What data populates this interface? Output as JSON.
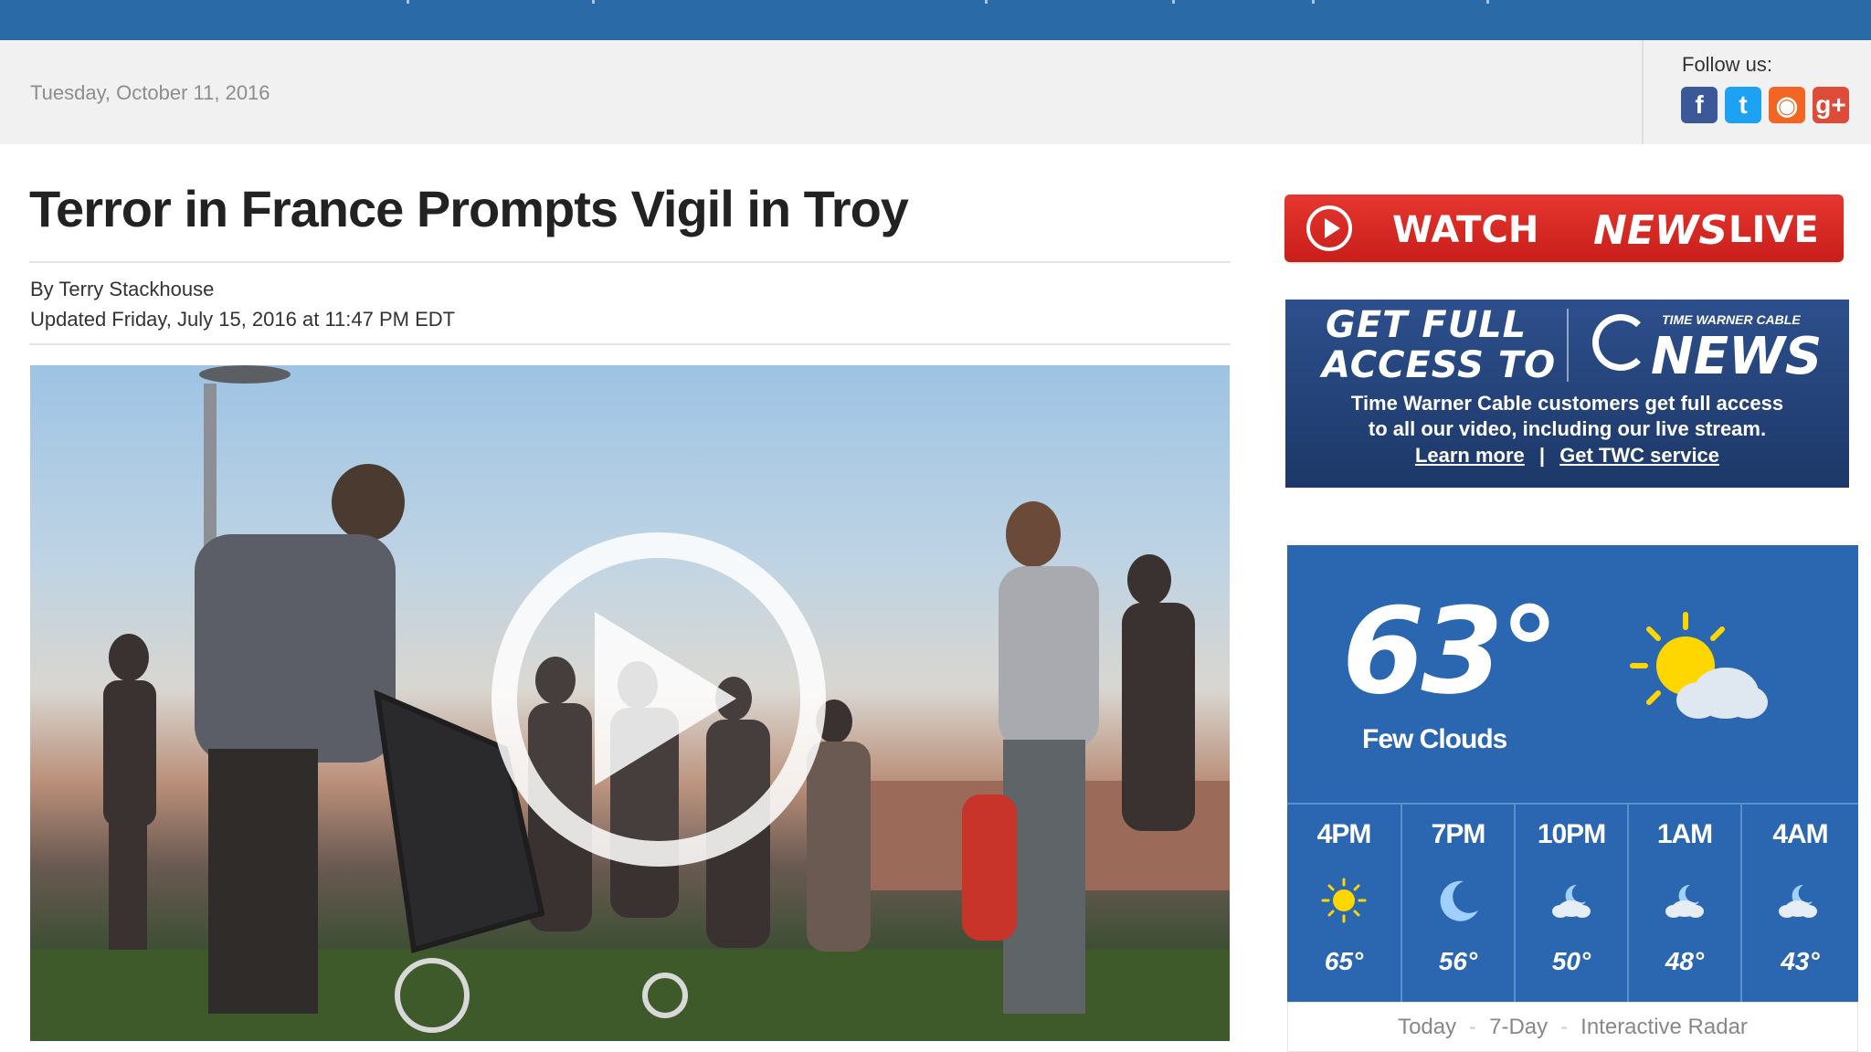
{
  "header": {
    "date": "Tuesday, October 11, 2016",
    "follow_label": "Follow us:",
    "social": [
      {
        "name": "facebook",
        "glyph": "f"
      },
      {
        "name": "twitter",
        "glyph": "t"
      },
      {
        "name": "rss",
        "glyph": "◉"
      },
      {
        "name": "google-plus",
        "glyph": "g+"
      }
    ]
  },
  "article": {
    "headline": "Terror in France Prompts Vigil in Troy",
    "byline": "By Terry Stackhouse",
    "updated": "Updated Friday, July 15, 2016 at 11:47 PM EDT"
  },
  "sidebar": {
    "watch": {
      "left": "WATCH",
      "logo": "NEWS",
      "right": "LIVE"
    },
    "promo": {
      "line1": "GET FULL",
      "line2": "ACCESS TO",
      "brand_small": "TIME WARNER CABLE",
      "brand": "NEWS",
      "body1": "Time Warner Cable customers get full access",
      "body2": "to all our video, including our live stream.",
      "link_learn": "Learn more",
      "link_sep": "|",
      "link_service": "Get TWC service"
    },
    "weather": {
      "temperature": "63°",
      "condition": "Few Clouds",
      "forecast": [
        {
          "time": "4PM",
          "temp": "65°",
          "icon": "sun-icon"
        },
        {
          "time": "7PM",
          "temp": "56°",
          "icon": "moon-icon"
        },
        {
          "time": "10PM",
          "temp": "50°",
          "icon": "cloud-moon-icon"
        },
        {
          "time": "1AM",
          "temp": "48°",
          "icon": "cloud-moon-icon"
        },
        {
          "time": "4AM",
          "temp": "43°",
          "icon": "cloud-moon-icon"
        }
      ],
      "tabs": {
        "today": "Today",
        "sep": "-",
        "seven_day": "7-Day",
        "radar": "Interactive Radar"
      }
    }
  },
  "colors": {
    "nav": "#2a6aa7",
    "watch_red": "#d52a24",
    "promo_navy": "#233f75",
    "weather_blue": "#2b67b0"
  }
}
